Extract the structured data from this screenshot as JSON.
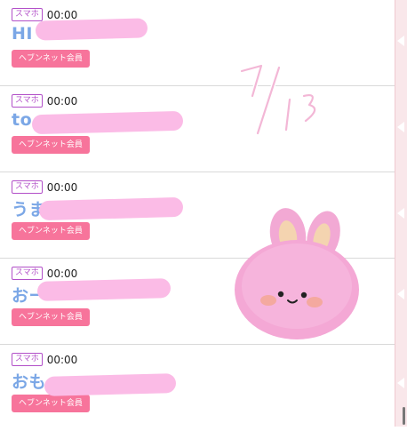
{
  "items": [
    {
      "device": "スマホ",
      "time": "00:00",
      "name": "HI",
      "member": "ヘブンネット会員"
    },
    {
      "device": "スマホ",
      "time": "00:00",
      "name": "to",
      "member": "ヘブンネット会員"
    },
    {
      "device": "スマホ",
      "time": "00:00",
      "name": "うま",
      "member": "ヘブンネット会員"
    },
    {
      "device": "スマホ",
      "time": "00:00",
      "name": "おー",
      "member": "ヘブンネット会員"
    },
    {
      "device": "スマホ",
      "time": "00:00",
      "name": "おも",
      "member": "ヘブンネット会員"
    }
  ],
  "handwritten_date": "7/13",
  "sticker": "pink-bunny-sticker",
  "colors": {
    "name_text": "#7ba7e6",
    "member_badge": "#f7749b",
    "device_badge": "#b24fc8",
    "scribble": "#fbbbe6",
    "sidebar": "#f9e7ea"
  }
}
